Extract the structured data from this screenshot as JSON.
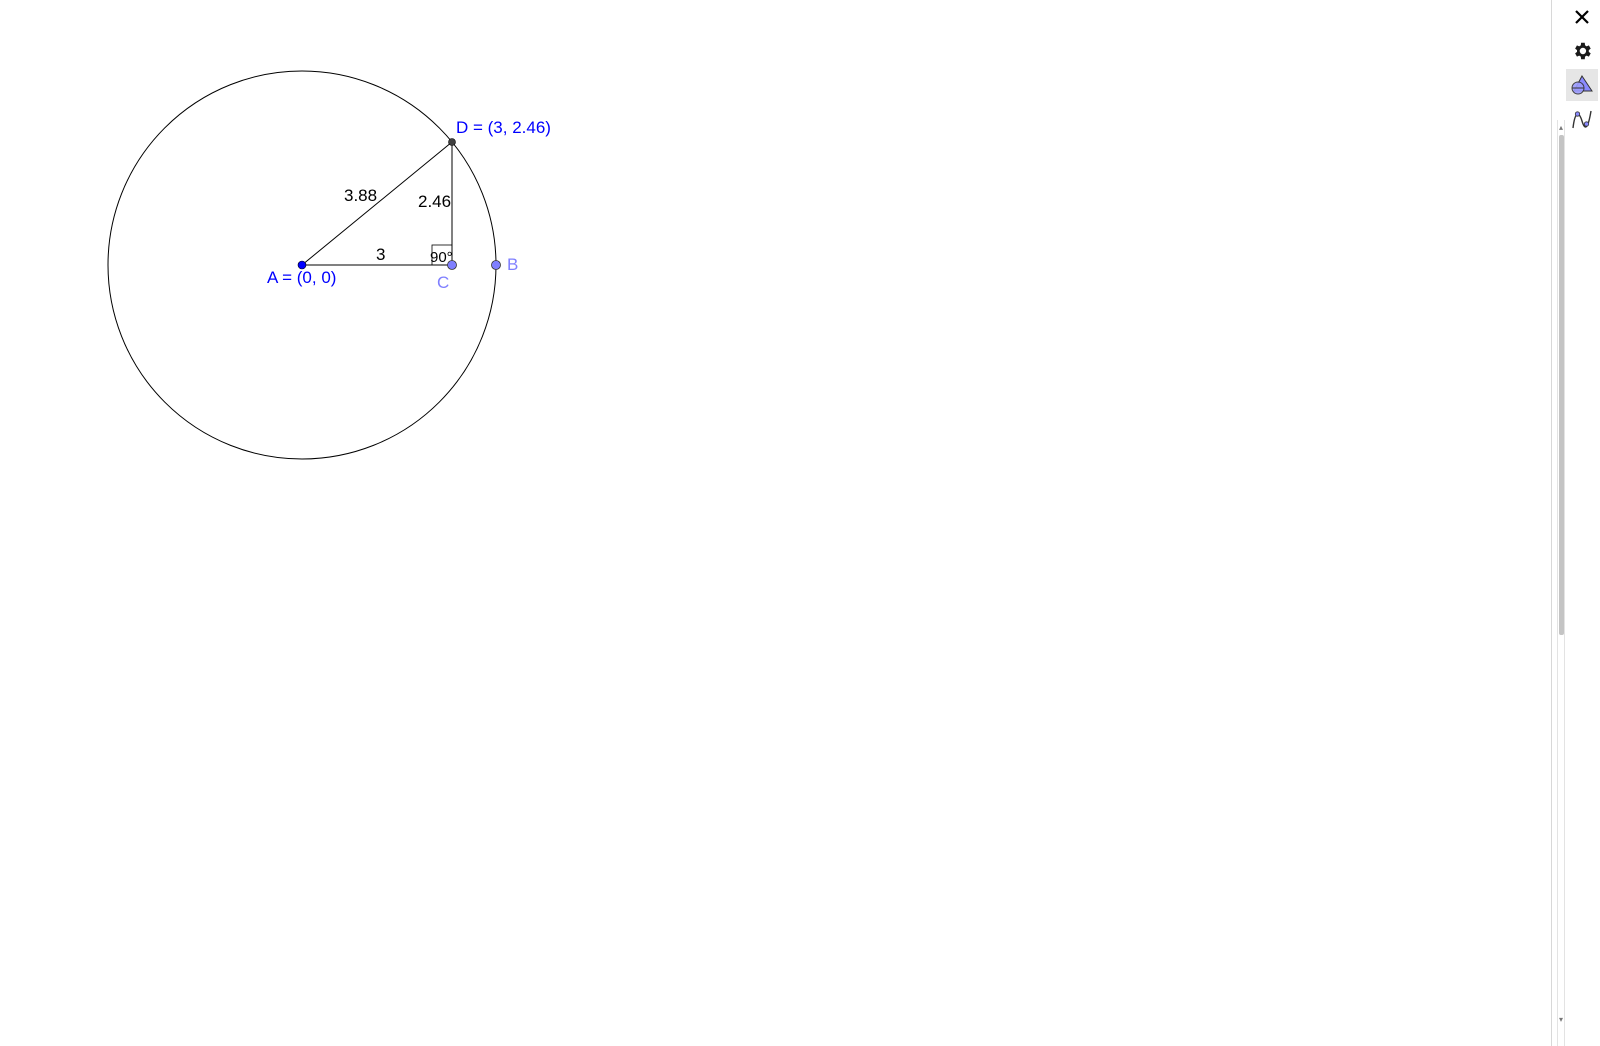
{
  "toolbar": {
    "close_icon": "close-icon",
    "settings_icon": "gear-icon",
    "graphics_view_icon": "geometry-view-icon",
    "graphics2_view_icon": "function-graph-icon"
  },
  "construction": {
    "points": {
      "A": {
        "label": "A = (0, 0)",
        "x": 0,
        "y": 0
      },
      "B": {
        "label": "B",
        "x": 3.88,
        "y": 0
      },
      "C": {
        "label": "C",
        "x": 3,
        "y": 0
      },
      "D": {
        "label": "D = (3, 2.46)",
        "x": 3,
        "y": 2.46
      }
    },
    "circle": {
      "center": "A",
      "through": "B",
      "radius": 3.88
    },
    "segments": {
      "AD": {
        "value": "3.88"
      },
      "CD": {
        "value": "2.46"
      },
      "AC": {
        "value": "3"
      }
    },
    "angle": {
      "value": "90°",
      "vertex": "C"
    }
  },
  "colors": {
    "free_point": "#0000ff",
    "dependent_point": "#7f7fff",
    "point_on_path": "#404040",
    "line": "#000000",
    "label_dependent": "#7f7fff"
  }
}
